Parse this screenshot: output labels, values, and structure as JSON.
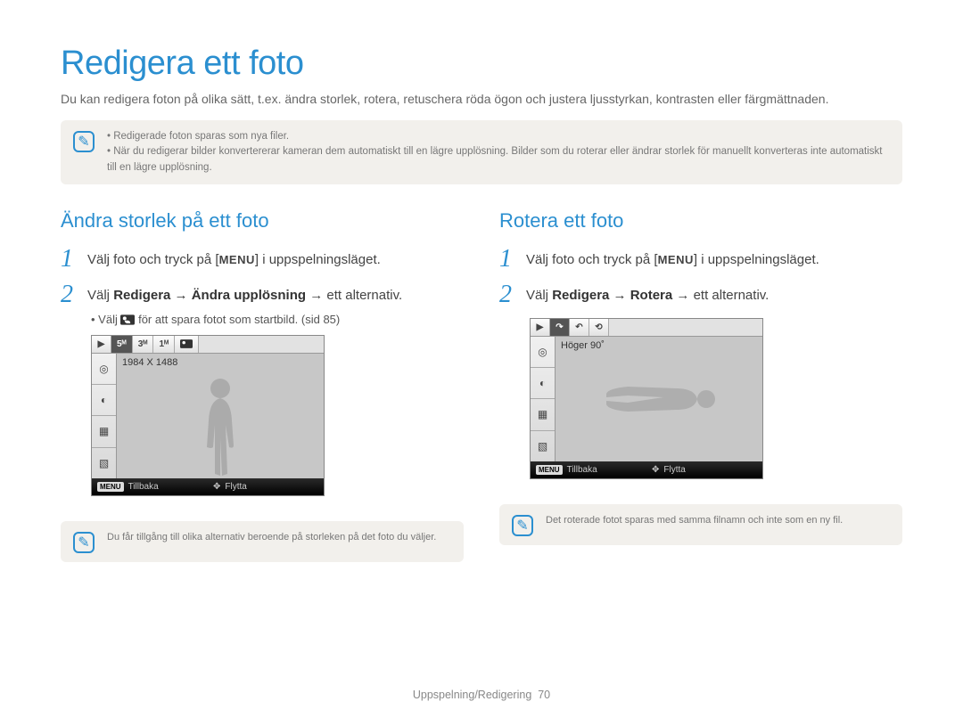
{
  "page_title": "Redigera ett foto",
  "intro": "Du kan redigera foton på olika sätt, t.ex. ändra storlek, rotera, retuschera röda ögon och justera ljusstyrkan, kontrasten eller färgmättnaden.",
  "top_note": {
    "items": [
      "Redigerade foton sparas som nya filer.",
      "När du redigerar bilder konvertererar kameran dem automatiskt till en lägre upplösning. Bilder som du roterar eller ändrar storlek för manuellt konverteras inte automatiskt till en lägre upplösning."
    ]
  },
  "left": {
    "title": "Ändra storlek på ett foto",
    "step1_prefix": "Välj foto och tryck på [",
    "step1_chip": "MENU",
    "step1_suffix": "] i uppspelningsläget.",
    "step2_prefix": "Välj ",
    "step2_bold": "Redigera → Ändra upplösning",
    "step2_suffix": " → ett alternativ.",
    "sub_prefix": "Välj ",
    "sub_suffix": " för att spara fotot som startbild. (sid 85)",
    "screen": {
      "toolbar": [
        "▶",
        "5ᴹ",
        "3ᴹ",
        "1ᴹ",
        ""
      ],
      "toolbar_sel_index": 1,
      "caption": "1984 X 1488",
      "footer_left_chip": "MENU",
      "footer_left_label": "Tillbaka",
      "footer_right_icon": "✥",
      "footer_right_label": "Flytta"
    },
    "bottom_note": "Du får tillgång till olika alternativ beroende på storleken på det foto du väljer."
  },
  "right": {
    "title": "Rotera ett foto",
    "step1_prefix": "Välj foto och tryck på [",
    "step1_chip": "MENU",
    "step1_suffix": "] i uppspelningsläget.",
    "step2_prefix": "Välj ",
    "step2_bold": "Redigera → Rotera",
    "step2_suffix": " → ett alternativ.",
    "screen": {
      "toolbar": [
        "▶",
        "↷",
        "↶",
        "⟲",
        ""
      ],
      "toolbar_sel_index": 1,
      "caption": "Höger 90˚",
      "footer_left_chip": "MENU",
      "footer_left_label": "Tillbaka",
      "footer_right_icon": "✥",
      "footer_right_label": "Flytta"
    },
    "bottom_note": "Det roterade fotot sparas med samma filnamn och inte som en ny fil."
  },
  "footer": {
    "section": "Uppspelning/Redigering",
    "page": "70"
  }
}
